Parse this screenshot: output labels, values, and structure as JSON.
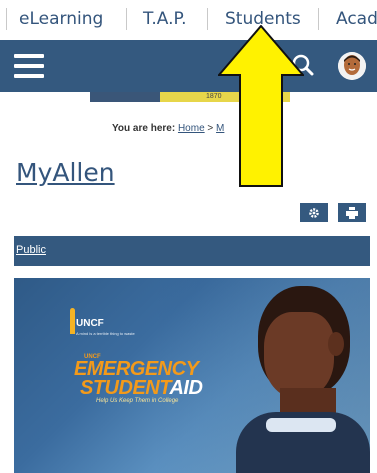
{
  "topnav": {
    "items": [
      "eLearning",
      "T.A.P.",
      "Students",
      "Acad"
    ]
  },
  "header": {
    "menu_icon": "hamburger-icon",
    "search_icon": "search-icon",
    "avatar": "user-avatar"
  },
  "banner": {
    "text": "1870"
  },
  "breadcrumb": {
    "prefix": "You are here:",
    "home": "Home",
    "sep": ">",
    "current": "M"
  },
  "page": {
    "title": "MyAllen"
  },
  "toolbar": {
    "settings_icon": "gear-icon",
    "print_icon": "print-icon"
  },
  "section": {
    "label": "Public"
  },
  "hero": {
    "logo": "UNCF",
    "tagline": "A mind is a terrible thing to waste",
    "line0": "UNCF",
    "line1": "EMERGENCY",
    "line2a": "STUDENT",
    "line2b": "AID",
    "line3": "Help Us Keep Them in College"
  },
  "overlay": {
    "arrow_color": "#fff200"
  },
  "colors": {
    "brand": "#34597f",
    "link": "#34557c"
  }
}
